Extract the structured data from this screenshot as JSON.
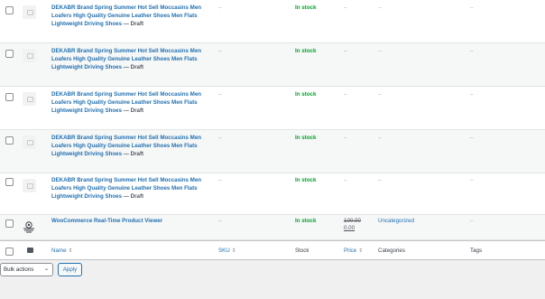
{
  "draft_products": [
    {
      "name": "DEKABR Brand Spring Summer Hot Sell Moccasins Men Loafers High Quality Genuine Leather Shoes Men Flats Lightweight Driving Shoes",
      "state": " — Draft",
      "sku": "–",
      "stock": "In stock",
      "price": "–",
      "categories": "–",
      "tags": "–"
    },
    {
      "name": "DEKABR Brand Spring Summer Hot Sell Moccasins Men Loafers High Quality Genuine Leather Shoes Men Flats Lightweight Driving Shoes",
      "state": " — Draft",
      "sku": "–",
      "stock": "In stock",
      "price": "–",
      "categories": "–",
      "tags": "–"
    },
    {
      "name": "DEKABR Brand Spring Summer Hot Sell Moccasins Men Loafers High Quality Genuine Leather Shoes Men Flats Lightweight Driving Shoes",
      "state": " — Draft",
      "sku": "–",
      "stock": "In stock",
      "price": "–",
      "categories": "–",
      "tags": "–"
    },
    {
      "name": "DEKABR Brand Spring Summer Hot Sell Moccasins Men Loafers High Quality Genuine Leather Shoes Men Flats Lightweight Driving Shoes",
      "state": " — Draft",
      "sku": "–",
      "stock": "In stock",
      "price": "–",
      "categories": "–",
      "tags": "–"
    },
    {
      "name": "DEKABR Brand Spring Summer Hot Sell Moccasins Men Loafers High Quality Genuine Leather Shoes Men Flats Lightweight Driving Shoes",
      "state": " — Draft",
      "sku": "–",
      "stock": "In stock",
      "price": "–",
      "categories": "–",
      "tags": "–"
    }
  ],
  "plugin_product": {
    "name": "WooCommerce Real-Time Product Viewer",
    "sku": "–",
    "stock": "In stock",
    "price_old": "100.00",
    "price_new": "0.00",
    "categories": "Uncategorized",
    "tags": "–",
    "icon": "product-viewer-icon"
  },
  "columns": {
    "name": "Name",
    "sku": "SKU",
    "stock": "Stock",
    "price": "Price",
    "categories": "Categories",
    "tags": "Tags"
  },
  "bulk_actions": {
    "selected": "Bulk actions",
    "apply_label": "Apply"
  },
  "colors": {
    "link": "#2271b1",
    "in_stock": "#00a32a",
    "background": "#f0f0f1"
  }
}
